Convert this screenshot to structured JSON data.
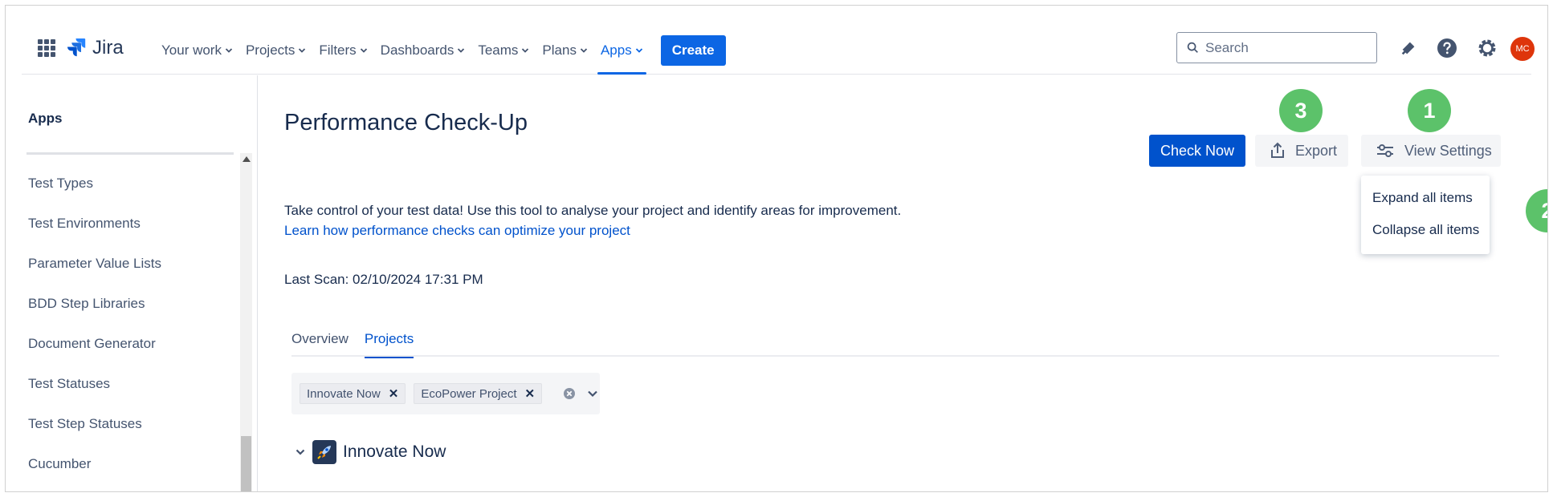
{
  "nav": {
    "logo_text": "Jira",
    "items": [
      {
        "label": "Your work"
      },
      {
        "label": "Projects"
      },
      {
        "label": "Filters"
      },
      {
        "label": "Dashboards"
      },
      {
        "label": "Teams"
      },
      {
        "label": "Plans"
      },
      {
        "label": "Apps",
        "active": true
      }
    ],
    "create_label": "Create",
    "search_placeholder": "Search",
    "avatar_initials": "MC",
    "accent_color": "#0c66e4"
  },
  "sidebar": {
    "title": "Apps",
    "items": [
      {
        "label": "Test Types"
      },
      {
        "label": "Test Environments"
      },
      {
        "label": "Parameter Value Lists"
      },
      {
        "label": "BDD Step Libraries"
      },
      {
        "label": "Document Generator"
      },
      {
        "label": "Test Statuses"
      },
      {
        "label": "Test Step Statuses"
      },
      {
        "label": "Cucumber"
      }
    ]
  },
  "main": {
    "title": "Performance Check-Up",
    "check_now_label": "Check Now",
    "export_label": "Export",
    "view_settings_label": "View Settings",
    "settings_menu": [
      "Expand all items",
      "Collapse all items"
    ],
    "description": "Take control of your test data! Use this tool to analyse your project and identify areas for improvement.",
    "learn_link": "Learn how performance checks can optimize your project",
    "last_scan": "Last Scan: 02/10/2024 17:31 PM",
    "tabs": [
      {
        "label": "Overview"
      },
      {
        "label": "Projects",
        "active": true
      }
    ],
    "selected_projects": [
      "Innovate Now",
      "EcoPower Project"
    ],
    "project_group": "Innovate Now"
  },
  "callouts": [
    "1",
    "2",
    "3"
  ],
  "colors": {
    "callout": "#5cc26a",
    "primary_button": "#0052cc",
    "avatar": "#de350b"
  }
}
